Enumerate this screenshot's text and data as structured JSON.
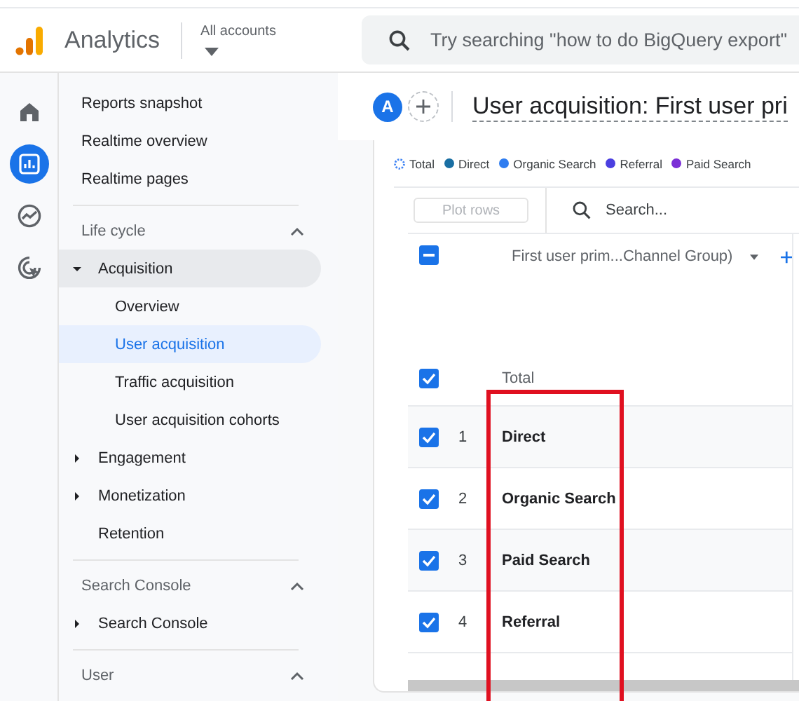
{
  "app": {
    "name": "Analytics",
    "account_label": "All accounts"
  },
  "search": {
    "placeholder": "Try searching \"how to do BigQuery export\""
  },
  "rail": [
    {
      "kind": "home",
      "selected": false
    },
    {
      "kind": "reports",
      "selected": true
    },
    {
      "kind": "explore",
      "selected": false
    },
    {
      "kind": "advertising",
      "selected": false
    }
  ],
  "nav": {
    "top": [
      {
        "label": "Reports snapshot",
        "selected": false
      },
      {
        "label": "Realtime overview",
        "selected": false
      },
      {
        "label": "Realtime pages",
        "selected": false
      }
    ],
    "sections": [
      {
        "title": "Life cycle",
        "expanded": true,
        "items": [
          {
            "label": "Acquisition",
            "kind": "group",
            "expanded": true,
            "children": [
              {
                "label": "Overview",
                "selected": false
              },
              {
                "label": "User acquisition",
                "selected": true
              },
              {
                "label": "Traffic acquisition",
                "selected": false
              },
              {
                "label": "User acquisition cohorts",
                "selected": false
              }
            ]
          },
          {
            "label": "Engagement",
            "kind": "group",
            "expanded": false
          },
          {
            "label": "Monetization",
            "kind": "group",
            "expanded": false
          },
          {
            "label": "Retention",
            "kind": "page",
            "selected": false
          }
        ]
      },
      {
        "title": "Search Console",
        "expanded": true,
        "items": [
          {
            "label": "Search Console",
            "kind": "group",
            "expanded": false
          }
        ]
      },
      {
        "title": "User",
        "expanded": true
      }
    ]
  },
  "report": {
    "avatar": "A",
    "title": "User acquisition: First user pri",
    "legend": [
      {
        "label": "Total",
        "kind": "total",
        "color": "#4285f4"
      },
      {
        "label": "Direct",
        "kind": "series",
        "color": "#1a6fa3"
      },
      {
        "label": "Organic Search",
        "kind": "series",
        "color": "#2f7df0"
      },
      {
        "label": "Referral",
        "kind": "series",
        "color": "#4b3fe0"
      },
      {
        "label": "Paid Search",
        "kind": "series",
        "color": "#7b2fd6"
      }
    ],
    "plot_button": {
      "label": "Plot rows",
      "disabled": true
    },
    "table_search": {
      "placeholder": "Search..."
    },
    "header_checkbox": {
      "partial": true
    },
    "dimension": "First user prim...Channel Group)",
    "total": {
      "label": "Total",
      "checked": true
    },
    "rows": [
      {
        "index": "1",
        "name": "Direct",
        "checked": true
      },
      {
        "index": "2",
        "name": "Organic Search",
        "checked": true
      },
      {
        "index": "3",
        "name": "Paid Search",
        "checked": true
      },
      {
        "index": "4",
        "name": "Referral",
        "checked": true
      }
    ]
  },
  "annotation": {
    "kind": "highlight-box"
  }
}
